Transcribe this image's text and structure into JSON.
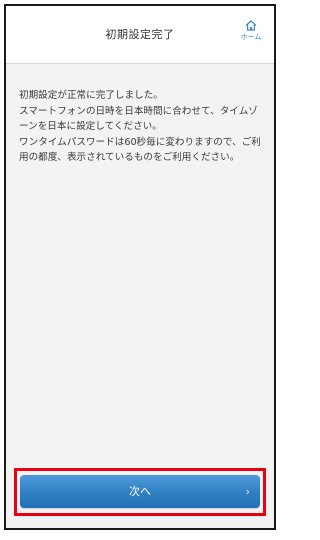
{
  "header": {
    "title": "初期設定完了",
    "home_label": "ホーム",
    "home_icon": "home-icon"
  },
  "message": {
    "paragraph1": "初期設定が正常に完了しました。\nスマートフォンの日時を日本時間に合わせて、タイムゾーンを日本に設定してください。",
    "paragraph2": "ワンタイムパスワードは60秒毎に変わりますので、ご利用の都度、表示されているものをご利用ください。"
  },
  "footer": {
    "next_label": "次へ",
    "next_chevron": "›",
    "chevron_icon": "chevron-right-icon"
  },
  "colors": {
    "button_blue": "#2f7fc4",
    "highlight_red": "#e60012",
    "home_blue": "#3a86c9",
    "background": "#f3f3f3"
  }
}
